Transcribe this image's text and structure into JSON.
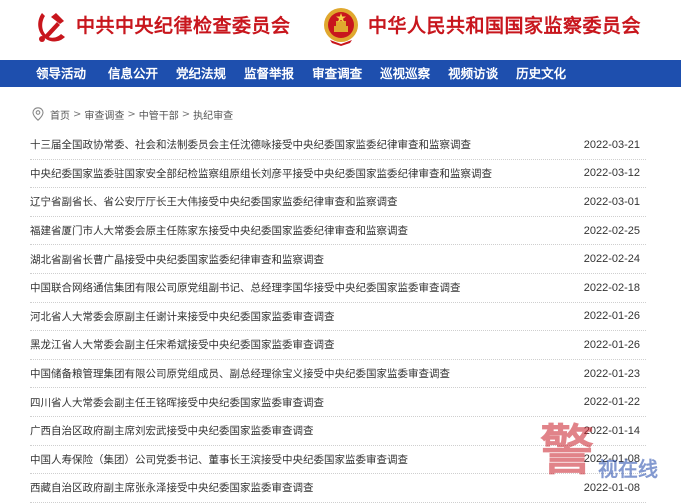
{
  "header": {
    "left_title": "中共中央纪律检查委员会",
    "right_title": "中华人民共和国国家监察委员会",
    "left_emblem": "party-emblem-icon",
    "right_emblem": "national-emblem-icon"
  },
  "colors": {
    "brand_red": "#c8161d",
    "nav_blue": "#1e4fae"
  },
  "nav": {
    "items": [
      "领导活动",
      "信息公开",
      "党纪法规",
      "监督举报",
      "审查调查",
      "巡视巡察",
      "视频访谈",
      "历史文化"
    ]
  },
  "breadcrumb": {
    "icon": "location-pin-icon",
    "items": [
      "首页",
      "审查调查",
      "中管干部",
      "执纪审查"
    ],
    "separator": ">"
  },
  "list": {
    "rows": [
      {
        "title": "十三届全国政协常委、社会和法制委员会主任沈德咏接受中央纪委国家监委纪律审查和监察调查",
        "date": "2022-03-21"
      },
      {
        "title": "中央纪委国家监委驻国家安全部纪检监察组原组长刘彦平接受中央纪委国家监委纪律审查和监察调查",
        "date": "2022-03-12"
      },
      {
        "title": "辽宁省副省长、省公安厅厅长王大伟接受中央纪委国家监委纪律审查和监察调查",
        "date": "2022-03-01"
      },
      {
        "title": "福建省厦门市人大常委会原主任陈家东接受中央纪委国家监委纪律审查和监察调查",
        "date": "2022-02-25"
      },
      {
        "title": "湖北省副省长曹广晶接受中央纪委国家监委纪律审查和监察调查",
        "date": "2022-02-24"
      },
      {
        "title": "中国联合网络通信集团有限公司原党组副书记、总经理李国华接受中央纪委国家监委审查调查",
        "date": "2022-02-18"
      },
      {
        "title": "河北省人大常委会原副主任谢计来接受中央纪委国家监委审查调查",
        "date": "2022-01-26"
      },
      {
        "title": "黑龙江省人大常委会副主任宋希斌接受中央纪委国家监委审查调查",
        "date": "2022-01-26"
      },
      {
        "title": "中国储备粮管理集团有限公司原党组成员、副总经理徐宝义接受中央纪委国家监委审查调查",
        "date": "2022-01-23"
      },
      {
        "title": "四川省人大常委会副主任王铭晖接受中央纪委国家监委审查调查",
        "date": "2022-01-22"
      },
      {
        "title": "广西自治区政府副主席刘宏武接受中央纪委国家监委审查调查",
        "date": "2022-01-14"
      },
      {
        "title": "中国人寿保险（集团）公司党委书记、董事长王滨接受中央纪委国家监委审查调查",
        "date": "2022-01-08"
      },
      {
        "title": "西藏自治区政府副主席张永泽接受中央纪委国家监委审查调查",
        "date": "2022-01-08"
      }
    ]
  },
  "watermark": {
    "seal_char": "警",
    "text": "视在线"
  }
}
